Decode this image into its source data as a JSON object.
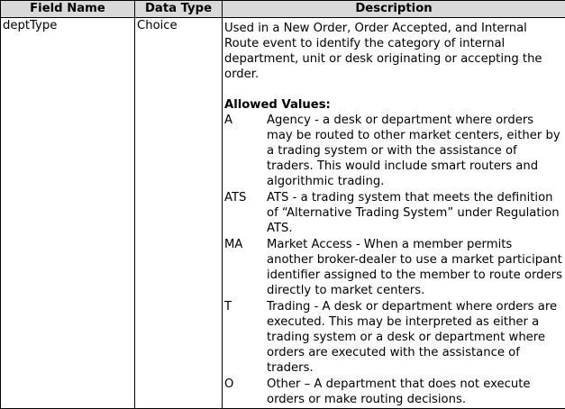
{
  "table": {
    "headers": [
      "Field Name",
      "Data Type",
      "Description"
    ],
    "row": {
      "field_name": "deptType",
      "data_type": "Choice",
      "description": "Used in a New Order, Order Accepted, and Internal Route event to identify the category of internal department, unit or desk originating or accepting the order.",
      "allowed_values_label": "Allowed Values:",
      "allowed_values": [
        {
          "code": "A",
          "description": "Agency - a desk or department where orders may be routed to other market centers, either by a trading system or with the assistance of traders. This would include smart routers and algorithmic trading."
        },
        {
          "code": "ATS",
          "description": "ATS - a trading system that meets the definition of “Alternative Trading System” under Regulation ATS."
        },
        {
          "code": "MA",
          "description": "Market Access - When a member permits another broker-dealer to use a market participant identifier assigned to the member to route orders directly to market centers."
        },
        {
          "code": "T",
          "description": "Trading - A desk or department where orders are executed. This may be interpreted as either a trading system or a desk or department where orders are executed with the assistance of traders."
        },
        {
          "code": "O",
          "description": "Other – A department that does not execute orders or make routing decisions."
        }
      ]
    }
  }
}
